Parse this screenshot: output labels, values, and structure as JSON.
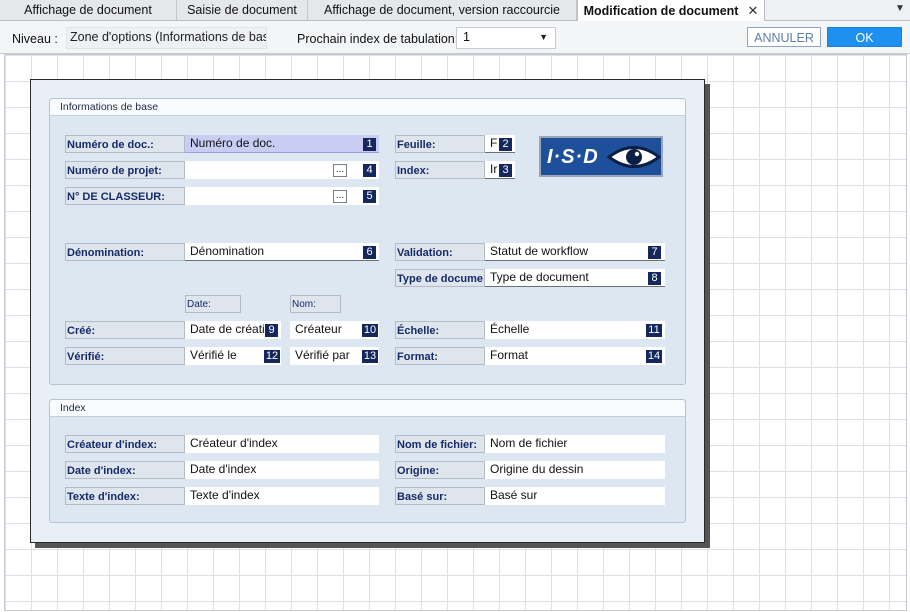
{
  "tabs": [
    {
      "label": "Affichage de document"
    },
    {
      "label": "Saisie de document"
    },
    {
      "label": "Affichage de document, version raccourcie"
    },
    {
      "label": "Modification de document"
    }
  ],
  "toolbar": {
    "niveau_label": "Niveau :",
    "niveau_value": "Zone d'options (Informations de bas",
    "tab_index_label": "Prochain index de tabulation:",
    "tab_index_value": "1",
    "cancel_label": "ANNULER",
    "ok_label": "OK"
  },
  "form": {
    "section_base": {
      "title": "Informations de base",
      "logo_text": "I·S·D",
      "fields": {
        "numero_doc": {
          "label": "Numéro de doc.:",
          "value": "Numéro de doc.",
          "index": "1"
        },
        "numero_projet": {
          "label": "Numéro de projet:",
          "value": "",
          "index": "4"
        },
        "classeur": {
          "label": "N° DE CLASSEUR:",
          "value": "",
          "index": "5"
        },
        "feuille": {
          "label": "Feuille:",
          "value": "F",
          "index": "2"
        },
        "index": {
          "label": "Index:",
          "value": "Ir",
          "index": "3"
        },
        "denomination": {
          "label": "Dénomination:",
          "value": "Dénomination",
          "index": "6"
        },
        "validation": {
          "label": "Validation:",
          "value": "Statut de workflow",
          "index": "7"
        },
        "type_document": {
          "label": "Type de docume",
          "value": "Type de document",
          "index": "8"
        },
        "date_header": "Date:",
        "nom_header": "Nom:",
        "cree": {
          "label": "Créé:",
          "date_value": "Date de créati",
          "date_index": "9",
          "nom_value": "Créateur",
          "nom_index": "10"
        },
        "verifie": {
          "label": "Vérifié:",
          "date_value": "Vérifié le",
          "date_index": "12",
          "nom_value": "Vérifié par",
          "nom_index": "13"
        },
        "echelle": {
          "label": "Échelle:",
          "value": "Échelle",
          "index": "11"
        },
        "format": {
          "label": "Format:",
          "value": "Format",
          "index": "14"
        }
      },
      "dots_label": "..."
    },
    "section_index": {
      "title": "Index",
      "fields": {
        "createur_index": {
          "label": "Créateur d'index:",
          "value": "Créateur d'index"
        },
        "date_index": {
          "label": "Date d'index:",
          "value": "Date d'index"
        },
        "texte_index": {
          "label": "Texte d'index:",
          "value": "Texte d'index"
        },
        "nom_fichier": {
          "label": "Nom de fichier:",
          "value": "Nom de fichier"
        },
        "origine": {
          "label": "Origine:",
          "value": "Origine du dessin"
        },
        "base_sur": {
          "label": "Basé sur:",
          "value": "Basé sur"
        }
      }
    }
  }
}
